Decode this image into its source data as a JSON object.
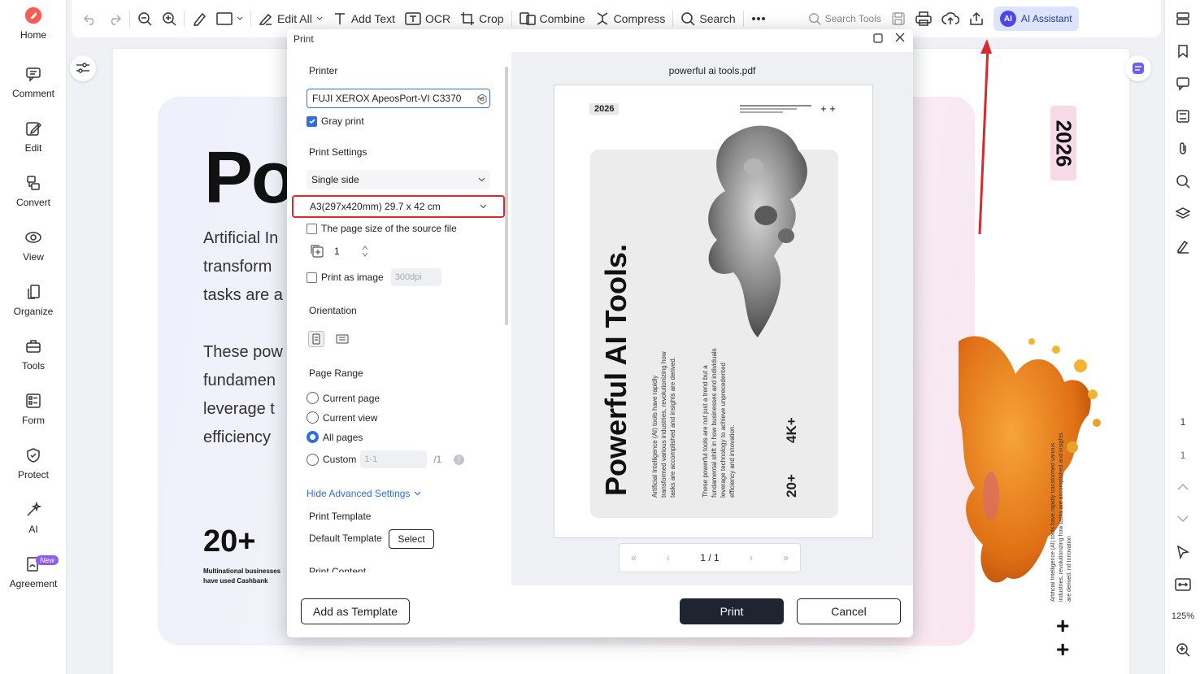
{
  "left_sidebar": {
    "items": [
      {
        "label": "Home",
        "icon": "home-logo-icon"
      },
      {
        "label": "Comment",
        "icon": "comment-icon"
      },
      {
        "label": "Edit",
        "icon": "edit-icon"
      },
      {
        "label": "Convert",
        "icon": "convert-icon"
      },
      {
        "label": "View",
        "icon": "view-icon"
      },
      {
        "label": "Organize",
        "icon": "organize-icon"
      },
      {
        "label": "Tools",
        "icon": "tools-icon"
      },
      {
        "label": "Form",
        "icon": "form-icon"
      },
      {
        "label": "Protect",
        "icon": "protect-icon"
      },
      {
        "label": "AI",
        "icon": "ai-sparkle-icon"
      },
      {
        "label": "Agreement",
        "icon": "agreement-icon",
        "badge": "New"
      }
    ]
  },
  "toolbar": {
    "edit_all": "Edit All",
    "add_text": "Add Text",
    "ocr": "OCR",
    "crop": "Crop",
    "combine": "Combine",
    "compress": "Compress",
    "search": "Search",
    "search_tools": "Search Tools",
    "ai_assistant": "AI Assistant",
    "ai_badge": "AI"
  },
  "document": {
    "big_title": "Po",
    "para1": [
      "Artificial In",
      "transform",
      "tasks are a"
    ],
    "para2": [
      "These pow",
      "fundamen",
      "leverage t",
      "efficiency"
    ],
    "stat": "20+",
    "stat_caption": "Multinational businesses have used Cashbank",
    "year_tag": "2026",
    "right_vert_text": "Artificial Intelligence (AI) tools have rapidly transformed various industries, revolutionizing how tasks are accomplished and insights are derived. nd Innovation",
    "plus1": "+",
    "plus2": "+"
  },
  "right_sidebar": {
    "page_num_top": "1",
    "page_num": "1",
    "zoom": "125%"
  },
  "print_dialog": {
    "title": "Print",
    "printer_label": "Printer",
    "printer_value": "FUJI XEROX ApeosPort-VI C3370",
    "gray_print": "Gray print",
    "gray_print_checked": true,
    "print_settings_label": "Print Settings",
    "sides_value": "Single side",
    "paper_value": "A3(297x420mm) 29.7 x 42 cm",
    "source_page_size": "The page size of the source file",
    "copies": "1",
    "print_as_image": "Print as image",
    "dpi": "300dpi",
    "orientation_label": "Orientation",
    "page_range_label": "Page Range",
    "range_current_page": "Current page",
    "range_current_view": "Current view",
    "range_all_pages": "All pages",
    "range_custom": "Custom",
    "custom_value": "1-1",
    "custom_total": "/1",
    "hide_advanced": "Hide Advanced Settings",
    "print_template_label": "Print Template",
    "default_template": "Default Template",
    "select_btn": "Select",
    "print_content_label": "Print Content",
    "add_template_btn": "Add as Template",
    "print_btn": "Print",
    "cancel_btn": "Cancel"
  },
  "preview": {
    "file_name": "powerful ai tools.pdf",
    "tag": "2026",
    "plus": "+ +",
    "title": "Powerful AI Tools.",
    "col1": [
      "Artificial Intelligence (AI) tools have rapidly",
      "transformed various industries, revolutionizing how",
      "tasks are accomplished and insights are derived."
    ],
    "col2": [
      "These powerful tools are not just a trend but a",
      "fundamental shift in how businesses and individuals",
      "leverage technology to achieve unprecedented",
      "efficiency and innovation."
    ],
    "stat1": "4K+",
    "stat2": "20+",
    "page_indicator": "1 / 1"
  },
  "colors": {
    "accent_blue": "#2f6fdc",
    "highlight_red": "#e0262b",
    "dark_button": "#1f2430",
    "coral_orange": "#e97a1b"
  }
}
